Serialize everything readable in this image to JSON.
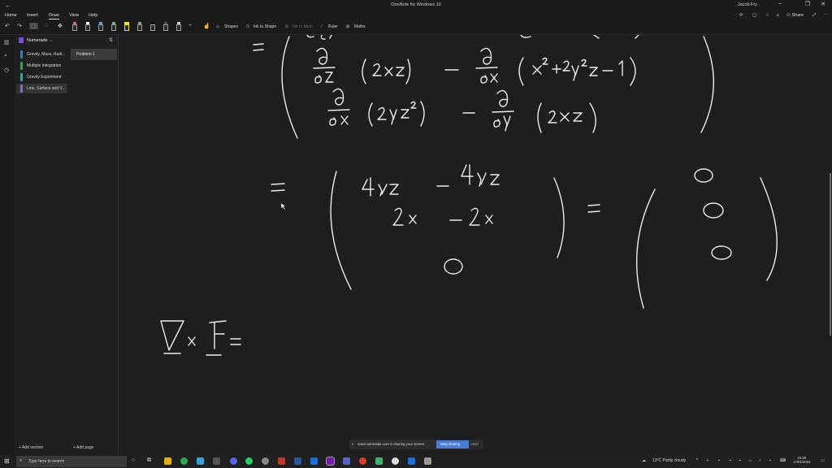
{
  "window": {
    "title": "OneNote for Windows 10",
    "user": "Jacob Fry"
  },
  "menu": {
    "home": "Home",
    "insert": "Insert",
    "draw": "Draw",
    "view": "View",
    "help": "Help"
  },
  "actions": {
    "share": "Share"
  },
  "toolbar": {
    "shapes": "Shapes",
    "ink_to_shape": "Ink to Shape",
    "ink_to_math": "Ink to Math",
    "ruler": "Ruler",
    "maths": "Maths"
  },
  "notebook": {
    "name": "Numerade",
    "sections": [
      {
        "label": "Gravity, Mass, Radi...",
        "color": "#2e7dd6"
      },
      {
        "label": "Multiple Integration",
        "color": "#22b04b"
      },
      {
        "label": "Gravity Experiment",
        "color": "#14b2a3"
      },
      {
        "label": "Line, Surface and V...",
        "color": "#7a6bd0"
      }
    ],
    "pages": [
      {
        "label": "Problem 1"
      }
    ],
    "add_section": "Add section",
    "add_page": "Add page"
  },
  "sharing_banner": {
    "text": "www.numerade.com is sharing your screen.",
    "stop": "Stop sharing",
    "hide": "Hide"
  },
  "taskbar": {
    "search_placeholder": "Type here to search",
    "weather": "13°C  Partly cloudy",
    "time": "16:29",
    "date": "17/01/2022"
  },
  "colors": {
    "accent": "#4a7bd6",
    "pen_yellow": "#f5e60a",
    "ink": "#ececec"
  }
}
